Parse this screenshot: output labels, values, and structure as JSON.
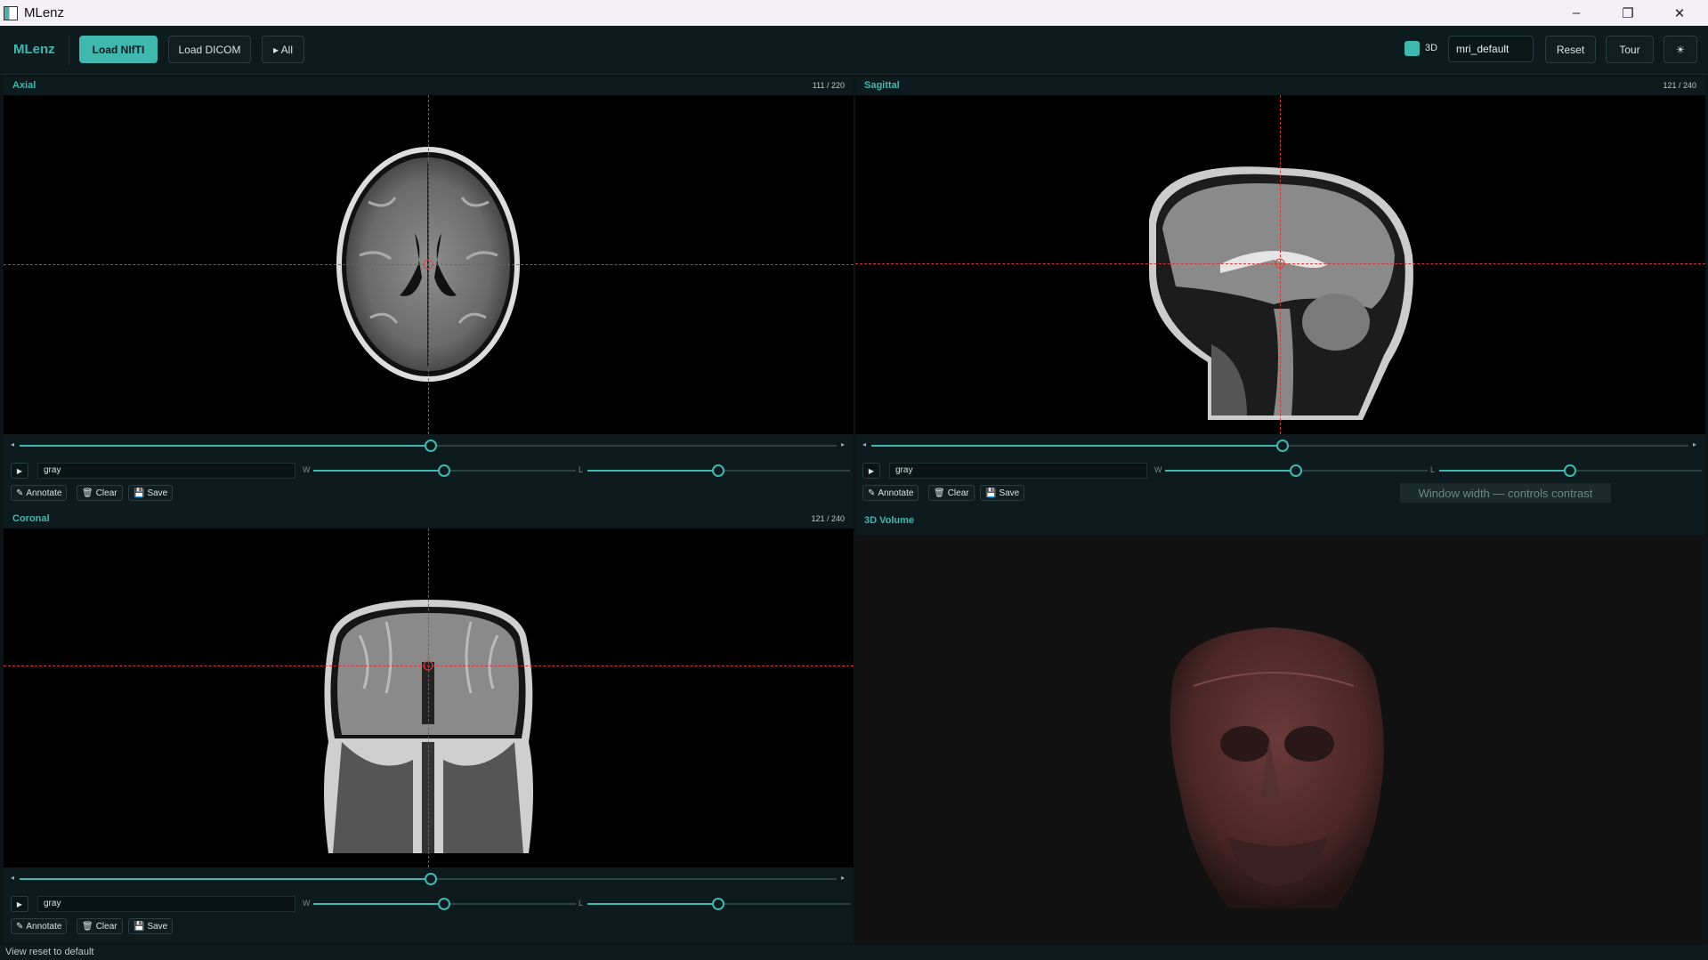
{
  "window": {
    "title": "MLenz"
  },
  "toolbar": {
    "brand": "MLenz",
    "load_nifti": "Load NIfTI",
    "load_dicom": "Load DICOM",
    "all_label": "▸ All",
    "toggle_3d_label": "3D",
    "toggle_3d_checked": true,
    "preset_value": "mri_default",
    "reset_label": "Reset",
    "tour_label": "Tour",
    "theme_icon": "☀"
  },
  "panels": {
    "axial": {
      "title": "Axial",
      "slice": "111 / 220",
      "slice_fraction": 0.5,
      "colormap": "gray",
      "window_fraction": 0.5,
      "level_fraction": 0.5
    },
    "sagittal": {
      "title": "Sagittal",
      "slice": "121 / 240",
      "slice_fraction": 0.5,
      "colormap": "gray",
      "window_fraction": 0.5,
      "level_fraction": 0.5
    },
    "coronal": {
      "title": "Coronal",
      "slice": "121 / 240",
      "slice_fraction": 0.5,
      "colormap": "gray",
      "window_fraction": 0.5,
      "level_fraction": 0.5
    },
    "volume": {
      "title": "3D Volume"
    }
  },
  "controls": {
    "play_icon": "▶",
    "w_label": "W",
    "l_label": "L",
    "annotate_label": "Annotate",
    "clear_label": "Clear",
    "save_label": "Save",
    "prev_arrow": "◂",
    "next_arrow": "▸"
  },
  "tooltip": "Window width — controls contrast",
  "status": "View reset to default",
  "colors": {
    "accent": "#3fb8b0",
    "crosshair": "#d03838",
    "panel_bg": "#0e1b1e"
  }
}
